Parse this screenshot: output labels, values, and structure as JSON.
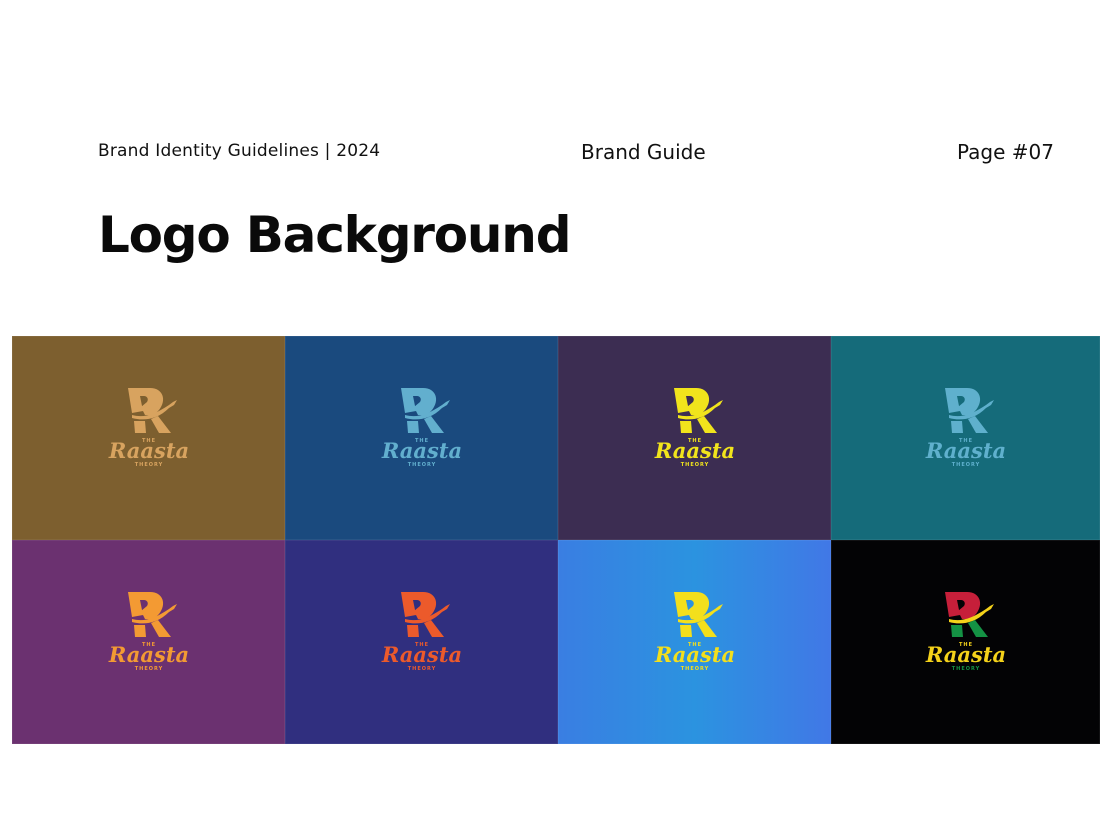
{
  "header": {
    "left": "Brand Identity Guidelines | 2024",
    "center": "Brand Guide",
    "right": "Page #07"
  },
  "title": "Logo Background",
  "logo": {
    "the": "THE",
    "name": "Raasta",
    "theory": "THEORY"
  },
  "tiles": [
    {
      "bg": "#7d5f2f",
      "mark": "#d8a35f",
      "text": "#d8a35f"
    },
    {
      "bg": "#1a4a7e",
      "mark": "#62afce",
      "text": "#62afce"
    },
    {
      "bg": "#3c2d52",
      "mark": "#f1e41c",
      "text": "#f1e41c"
    },
    {
      "bg": "#156b7a",
      "mark": "#5fb0cd",
      "text": "#5fb0cd"
    },
    {
      "bg": "#6b3170",
      "mark": "#f39a33",
      "text": "#f39a33"
    },
    {
      "bg": "#302f7f",
      "mark": "#ec5a2b",
      "text": "#ec5a2b"
    },
    {
      "bg": "#3a82e2",
      "mark": "#f3df1c",
      "text": "#f3df1c"
    },
    {
      "bg": "#030305",
      "mark": "#c61f3a",
      "mark2": "#f4d21a",
      "mark3": "#149244",
      "text": "#f4d21a"
    }
  ]
}
